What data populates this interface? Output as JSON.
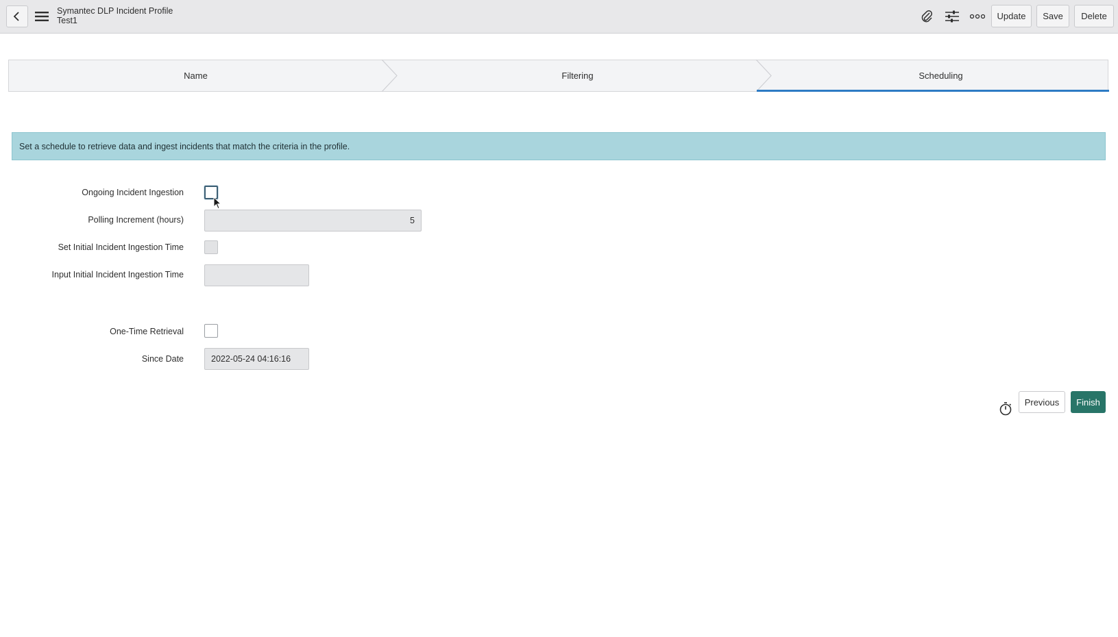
{
  "header": {
    "title": "Symantec DLP Incident Profile",
    "subtitle": "Test1",
    "buttons": {
      "update": "Update",
      "save": "Save",
      "delete": "Delete"
    },
    "icons": [
      "back-icon",
      "hamburger-menu-icon",
      "paperclip-icon",
      "settings-sliders-icon",
      "more-options-icon"
    ]
  },
  "stepper": {
    "steps": [
      {
        "label": "Name",
        "active": false
      },
      {
        "label": "Filtering",
        "active": false
      },
      {
        "label": "Scheduling",
        "active": true
      }
    ],
    "active_color": "#2d7bc4"
  },
  "banner": {
    "text": "Set a schedule to retrieve data and ingest incidents that match the criteria in the profile.",
    "color": "#a9d5dd"
  },
  "form": {
    "ongoing_ingestion": {
      "label": "Ongoing Incident Ingestion",
      "checked": false
    },
    "polling_increment": {
      "label": "Polling Increment (hours)",
      "value": "5"
    },
    "set_initial_time": {
      "label": "Set Initial Incident Ingestion Time",
      "checked": false
    },
    "input_initial_time": {
      "label": "Input Initial Incident Ingestion Time",
      "value": ""
    },
    "one_time_retrieval": {
      "label": "One-Time Retrieval",
      "checked": false
    },
    "since_date": {
      "label": "Since Date",
      "value": "2022-05-24 04:16:16"
    }
  },
  "actions": {
    "previous": "Previous",
    "finish": "Finish",
    "finish_color": "#287568"
  }
}
